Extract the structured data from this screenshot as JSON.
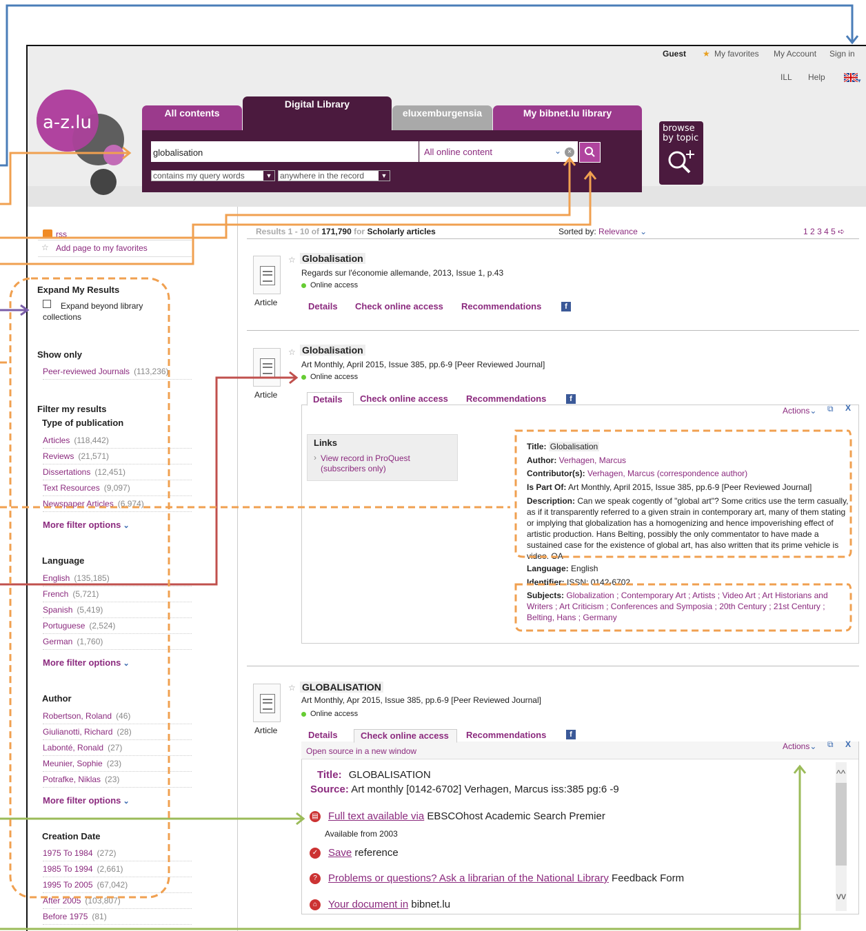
{
  "header": {
    "guest": "Guest",
    "my_favorites": "My favorites",
    "my_account": "My Account",
    "sign_in": "Sign in",
    "ill": "ILL",
    "help": "Help",
    "logo_text": "a-z.lu",
    "browse_topic": "browse by topic"
  },
  "tabs": [
    "All contents",
    "Digital Library",
    "eluxemburgensia",
    "My bibnet.lu library"
  ],
  "search": {
    "query": "globalisation",
    "scope": "All online content",
    "match": "contains my query words",
    "where": "anywhere in the record"
  },
  "sidebar": {
    "rss": "rss",
    "add_fav": "Add page to my favorites",
    "expand_title": "Expand My Results",
    "expand_label": "Expand beyond library collections",
    "show_only": "Show only",
    "peer": "Peer-reviewed Journals",
    "peer_count": "(113,236)",
    "filter_title": "Filter my results",
    "type_title": "Type of publication",
    "types": [
      {
        "label": "Articles",
        "count": "(118,442)"
      },
      {
        "label": "Reviews",
        "count": "(21,571)"
      },
      {
        "label": "Dissertations",
        "count": "(12,451)"
      },
      {
        "label": "Text Resources",
        "count": "(9,097)"
      },
      {
        "label": "Newspaper Articles",
        "count": "(6,974)"
      }
    ],
    "more": "More filter options",
    "language_title": "Language",
    "languages": [
      {
        "label": "English",
        "count": "(135,185)"
      },
      {
        "label": "French",
        "count": "(5,721)"
      },
      {
        "label": "Spanish",
        "count": "(5,419)"
      },
      {
        "label": "Portuguese",
        "count": "(2,524)"
      },
      {
        "label": "German",
        "count": "(1,760)"
      }
    ],
    "author_title": "Author",
    "authors": [
      {
        "label": "Robertson, Roland",
        "count": "(46)"
      },
      {
        "label": "Giulianotti, Richard",
        "count": "(28)"
      },
      {
        "label": "Labonté, Ronald",
        "count": "(27)"
      },
      {
        "label": "Meunier, Sophie",
        "count": "(23)"
      },
      {
        "label": "Potrafke, Niklas",
        "count": "(23)"
      }
    ],
    "date_title": "Creation Date",
    "dates": [
      {
        "label": "1975 To 1984",
        "count": "(272)"
      },
      {
        "label": "1985 To 1994",
        "count": "(2,661)"
      },
      {
        "label": "1995 To 2005",
        "count": "(67,042)"
      },
      {
        "label": "After 2005",
        "count": "(103,807)"
      },
      {
        "label": "Before 1975",
        "count": "(81)"
      }
    ]
  },
  "results_bar": {
    "results_prefix": "Results 1 - 10 of",
    "results_total": "171,790",
    "for_text": "for",
    "query_label": "Scholarly articles",
    "sorted_by": "Sorted by:",
    "sort_value": "Relevance",
    "pages": [
      "1",
      "2",
      "3",
      "4",
      "5"
    ]
  },
  "results": [
    {
      "title": "Globalisation",
      "source": "Regards sur l'économie allemande, 2013, Issue 1, p.43",
      "access": "Online access",
      "type": "Article",
      "details": "Details",
      "check": "Check online access",
      "recommend": "Recommendations"
    },
    {
      "title": "Globalisation",
      "source": "Art Monthly, April 2015, Issue 385, pp.6-9 [Peer Reviewed Journal]",
      "access": "Online access",
      "type": "Article",
      "details": "Details",
      "check": "Check online access",
      "recommend": "Recommendations",
      "actions": "Actions",
      "links_title": "Links",
      "links_item": "View record in ProQuest (subscribers only)",
      "fields": {
        "title_label": "Title:",
        "title_value": "Globalisation",
        "author_label": "Author:",
        "author_value": "Verhagen, Marcus",
        "contrib_label": "Contributor(s):",
        "contrib_value": "Verhagen, Marcus (correspondence author)",
        "partof_label": "Is Part Of:",
        "partof_value": "Art Monthly, April 2015, Issue 385, pp.6-9 [Peer Reviewed Journal]",
        "desc_label": "Description:",
        "desc_value": "Can we speak cogently of \"global art\"? Some critics use the term casually, as if it transparently referred to a given strain in contemporary art, many of them stating or implying that globalization has a homogenizing and hence impoverishing effect of artistic production. Hans Belting, possibly the only commentator to have made a sustained case for the existence of global art, has also written that its prime vehicle is video. OA",
        "lang_label": "Language:",
        "lang_value": "English",
        "ident_label": "Identifier:",
        "ident_value": "ISSN: 0142-6702",
        "subj_label": "Subjects:",
        "subj_value": "Globalization ; Contemporary Art ; Artists ; Video Art ; Art Historians and Writers ; Art Criticism ; Conferences and Symposia ; 20th Century ; 21st Century ; Belting, Hans ; Germany"
      }
    },
    {
      "title": "GLOBALISATION",
      "source": "Art Monthly, Apr 2015, Issue 385, pp.6-9 [Peer Reviewed Journal]",
      "access": "Online access",
      "type": "Article",
      "details": "Details",
      "check": "Check online access",
      "recommend": "Recommendations",
      "actions": "Actions",
      "open_source": "Open source in a new window",
      "title_label": "Title:",
      "title_value": "GLOBALISATION",
      "source_label": "Source:",
      "source_value": "Art monthly [0142-6702] Verhagen, Marcus iss:385 pg:6 -9",
      "fulltext_link": "Full text available via",
      "fulltext_rest": "EBSCOhost Academic Search Premier",
      "available": "Available from 2003",
      "save_link": "Save",
      "save_rest": "reference",
      "problems_link": "Problems or questions? Ask a librarian of the National Library",
      "problems_rest": "Feedback Form",
      "document_link": "Your document in",
      "document_rest": "bibnet.lu"
    }
  ],
  "colors": {
    "brand": "#8b2a7e",
    "tab_dark": "#4b1a3e",
    "arrow_blue": "#4a7db8",
    "arrow_orange": "#f0a050",
    "arrow_red": "#c0504d",
    "arrow_green": "#9bbb59",
    "arrow_purple": "#7a5ea8"
  }
}
